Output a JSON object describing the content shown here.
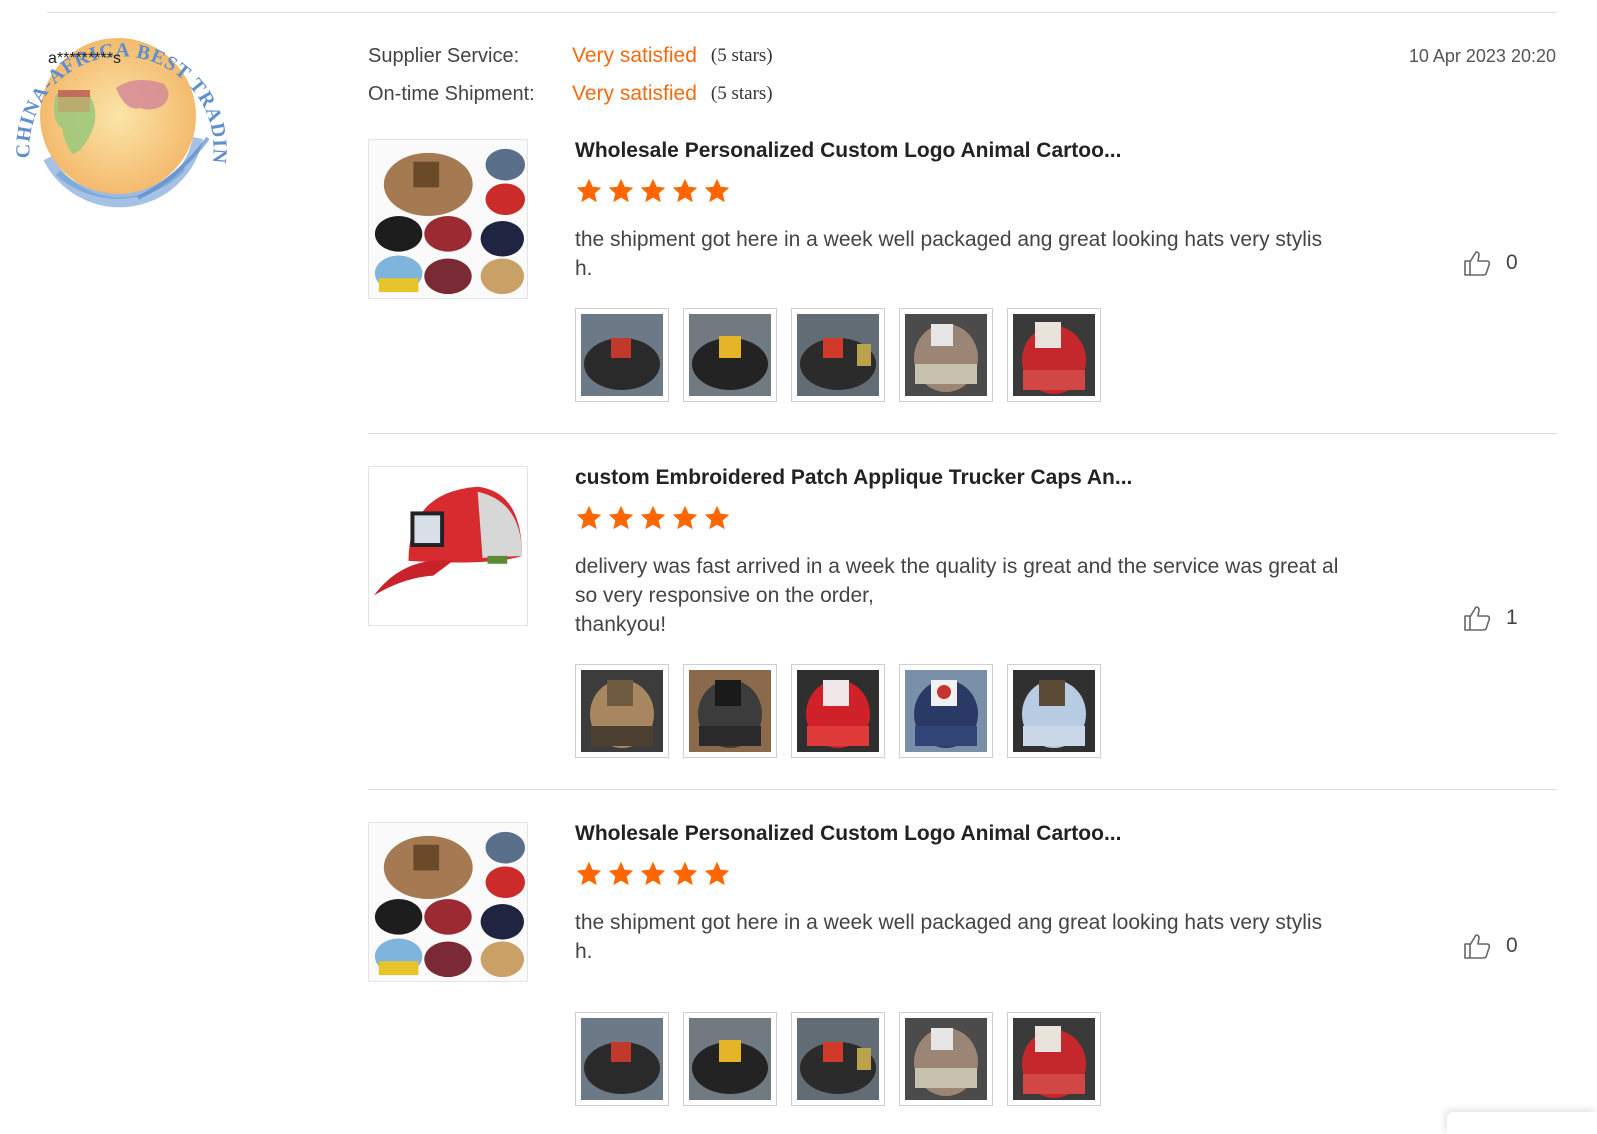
{
  "logo": {
    "text": "CHINA-AFRICA BEST TRADING PLATFORM",
    "icon": "china-africa-globe-logo"
  },
  "reviewer": {
    "name": "a*********s"
  },
  "ratings": [
    {
      "label": "Supplier Service:",
      "value": "Very satisfied",
      "stars": "(5 stars)"
    },
    {
      "label": "On-time Shipment:",
      "value": "Very satisfied",
      "stars": "(5 stars)"
    }
  ],
  "date": "10 Apr 2023 20:20",
  "colors": {
    "accent": "#f26b0f",
    "divider": "#dcdcdc"
  },
  "reviews": [
    {
      "title": "Wholesale Personalized Custom Logo Animal Cartoo...",
      "rating": 5,
      "comment": "the shipment got here in a week well packaged ang great looking hats very stylis\nh.",
      "likes": "0",
      "product_image": "multi-cap-grid",
      "photos": [
        "black-cap-red-patch",
        "black-cap-yellow-patch",
        "black-cap-red-patch-mesh",
        "beige-cap-white-patch",
        "red-cap-goat-patch"
      ]
    },
    {
      "title": "custom Embroidered Patch Applique Trucker Caps An...",
      "rating": 5,
      "comment": "delivery was fast arrived in a week the quality is great and the service was great al\nso very responsive on the order,\nthankyou!",
      "likes": "1",
      "product_image": "red-trucker-cap",
      "photos": [
        "brown-cap-lion-patch",
        "black-cap-panther-patch",
        "red-cap-bull-patch",
        "navy-cap-rooster-patch",
        "light-blue-cap-patch"
      ]
    },
    {
      "title": "Wholesale Personalized Custom Logo Animal Cartoo...",
      "rating": 5,
      "comment": "the shipment got here in a week well packaged ang great looking hats very stylis\nh.",
      "likes": "0",
      "product_image": "multi-cap-grid",
      "photos": [
        "black-cap-red-patch",
        "black-cap-yellow-patch",
        "black-cap-red-patch-mesh",
        "beige-cap-white-patch",
        "red-cap-goat-patch"
      ]
    }
  ]
}
